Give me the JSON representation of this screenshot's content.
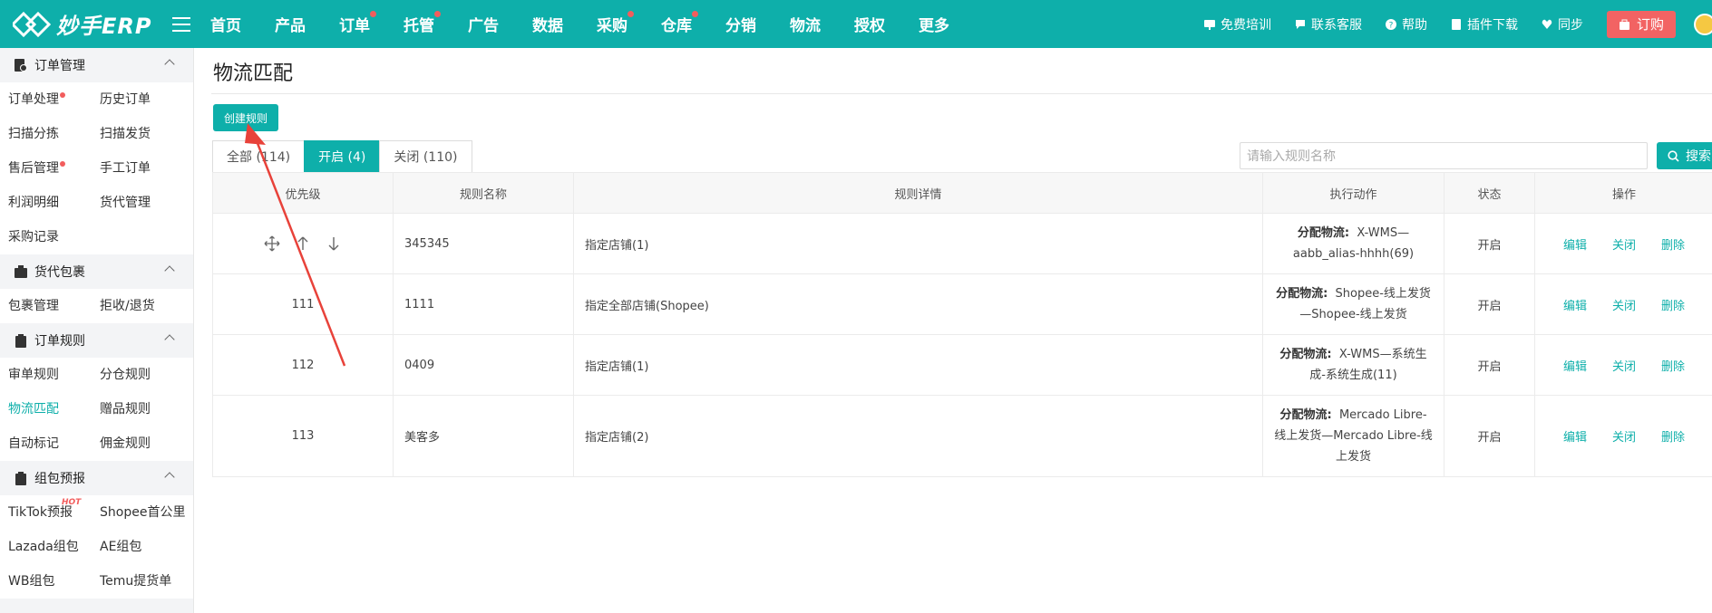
{
  "brand": {
    "logo_text": "妙手ERP"
  },
  "nav": [
    {
      "label": "首页",
      "dot": false
    },
    {
      "label": "产品",
      "dot": false
    },
    {
      "label": "订单",
      "dot": true
    },
    {
      "label": "托管",
      "dot": true
    },
    {
      "label": "广告",
      "dot": false
    },
    {
      "label": "数据",
      "dot": false
    },
    {
      "label": "采购",
      "dot": true
    },
    {
      "label": "仓库",
      "dot": true
    },
    {
      "label": "分销",
      "dot": false
    },
    {
      "label": "物流",
      "dot": false
    },
    {
      "label": "授权",
      "dot": false
    },
    {
      "label": "更多",
      "dot": false
    }
  ],
  "top_right": {
    "training": "免费培训",
    "contact": "联系客服",
    "help": "帮助",
    "plugin": "插件下载",
    "sync": "同步",
    "order": "订购"
  },
  "sidebar": {
    "order_mgmt": {
      "title": "订单管理",
      "items": [
        "订单处理",
        "历史订单",
        "扫描分拣",
        "扫描发货",
        "售后管理",
        "手工订单",
        "利润明细",
        "货代管理",
        "采购记录"
      ]
    },
    "forwarder": {
      "title": "货代包裹",
      "items": [
        "包裹管理",
        "拒收/退货"
      ]
    },
    "order_rules": {
      "title": "订单规则",
      "items": [
        "审单规则",
        "分仓规则",
        "物流匹配",
        "赠品规则",
        "自动标记",
        "佣金规则"
      ]
    },
    "pack": {
      "title": "组包预报",
      "hot": "HOT",
      "items": [
        "TikTok预报",
        "Shopee首公里",
        "Lazada组包",
        "AE组包",
        "WB组包",
        "Temu提货单"
      ]
    }
  },
  "page": {
    "title": "物流匹配",
    "create_button": "创建规则",
    "tabs": [
      "全部 (114)",
      "开启 (4)",
      "关闭 (110)"
    ],
    "search_placeholder": "请输入规则名称",
    "search_button": "搜索"
  },
  "table": {
    "headers": [
      "优先级",
      "规则名称",
      "规则详情",
      "执行动作",
      "状态",
      "操作"
    ],
    "action_label": "分配物流:",
    "ops": [
      "编辑",
      "关闭",
      "删除"
    ],
    "rows": [
      {
        "priority": "",
        "name": "345345",
        "detail": "指定店铺(1)",
        "action_lines": [
          "X-WMS—",
          "aabb_alias-hhhh(69)"
        ],
        "status": "开启"
      },
      {
        "priority": "111",
        "name": "1111",
        "detail": "指定全部店铺(Shopee)",
        "action_lines": [
          "Shopee-线上发货",
          "—Shopee-线上发货"
        ],
        "status": "开启"
      },
      {
        "priority": "112",
        "name": "0409",
        "detail": "指定店铺(1)",
        "action_lines": [
          "X-WMS—系统生",
          "成-系统生成(11)"
        ],
        "status": "开启"
      },
      {
        "priority": "113",
        "name": "美客多",
        "detail": "指定店铺(2)",
        "action_lines": [
          "Mercado Libre-",
          "线上发货—Mercado Libre-线",
          "上发货"
        ],
        "status": "开启"
      }
    ]
  },
  "colors": {
    "brand": "#0eafaa",
    "danger": "#f26363",
    "status_on": "#5cb85c",
    "annotation_arrow": "#e8423a"
  }
}
